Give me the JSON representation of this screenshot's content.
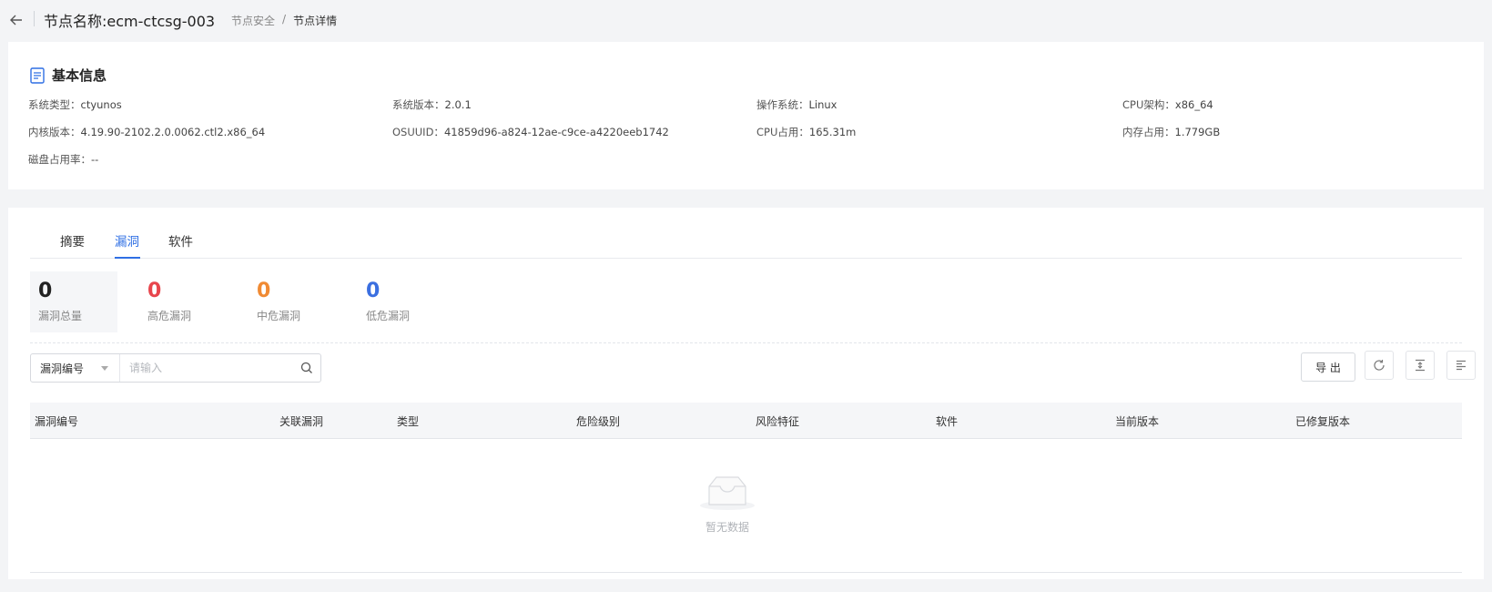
{
  "header": {
    "title": "节点名称:ecm-ctcsg-003",
    "breadcrumb": [
      {
        "label": "节点安全"
      },
      {
        "label": "/"
      },
      {
        "label": "节点详情"
      }
    ]
  },
  "basic_info": {
    "title": "基本信息",
    "items": [
      {
        "label": "系统类型：",
        "value": "ctyunos"
      },
      {
        "label": "系统版本：",
        "value": "2.0.1"
      },
      {
        "label": "操作系统：",
        "value": "Linux"
      },
      {
        "label": "CPU架构：",
        "value": "x86_64"
      },
      {
        "label": "内核版本：",
        "value": "4.19.90-2102.2.0.0062.ctl2.x86_64"
      },
      {
        "label": "OSUUID：",
        "value": "41859d96-a824-12ae-c9ce-a4220eeb1742"
      },
      {
        "label": "CPU占用：",
        "value": "165.31m"
      },
      {
        "label": "内存占用：",
        "value": "1.779GB"
      },
      {
        "label": "磁盘占用率：",
        "value": "--"
      }
    ]
  },
  "tabs": [
    {
      "label": "摘要"
    },
    {
      "label": "漏洞"
    },
    {
      "label": "软件"
    }
  ],
  "stats": [
    {
      "value": "0",
      "label": "漏洞总量",
      "color": "#222222"
    },
    {
      "value": "0",
      "label": "高危漏洞",
      "color": "#e8454c"
    },
    {
      "value": "0",
      "label": "中危漏洞",
      "color": "#f08a33"
    },
    {
      "value": "0",
      "label": "低危漏洞",
      "color": "#3b6fe0"
    }
  ],
  "filter": {
    "select_value": "漏洞编号",
    "placeholder": "请输入",
    "search_icon": "search-icon"
  },
  "toolbar": {
    "export_label": "导 出",
    "refresh_icon": "refresh-icon",
    "density_icon": "density-icon",
    "columns_icon": "columns-icon"
  },
  "table": {
    "columns": [
      "漏洞编号",
      "关联漏洞",
      "类型",
      "危险级别",
      "风险特征",
      "软件",
      "当前版本",
      "已修复版本"
    ],
    "empty_text": "暂无数据"
  },
  "colors": {
    "accent": "#2f6fe4",
    "background": "#f3f4f6"
  }
}
